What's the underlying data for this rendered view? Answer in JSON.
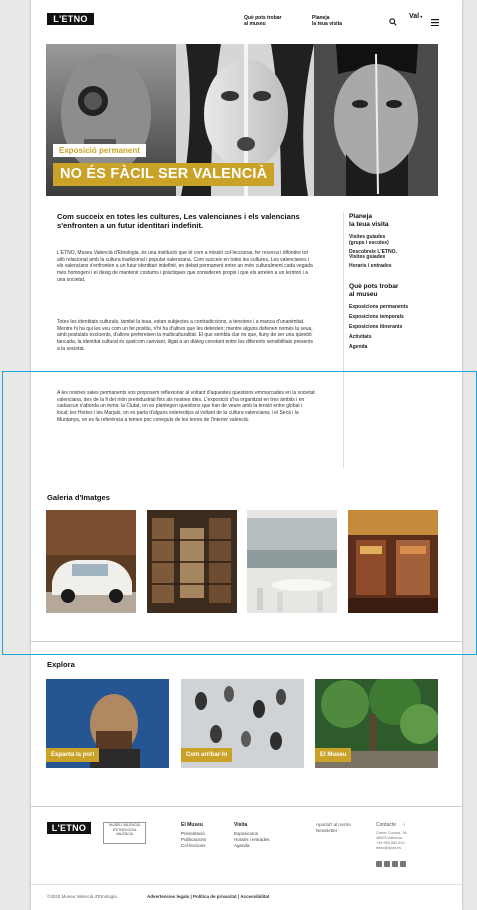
{
  "header": {
    "logo": "L'ETNO",
    "nav": [
      {
        "line1": "Què pots trobar",
        "line2": "al museu"
      },
      {
        "line1": "Planeja",
        "line2": "la teua visita"
      }
    ],
    "language": "Val",
    "search_icon": "search-icon",
    "menu_icon": "menu-icon"
  },
  "hero": {
    "badge": "Exposició permanent",
    "title": "NO ÉS FÀCIL SER VALENCIÀ"
  },
  "intro": {
    "lead": "Com succeix en totes les cultures, Les valencianes i els valencians s'enfronten a un futur identitari indefinit.",
    "p1": "L'ETNO, Museu Valencià d'Etnologia, és una institució que té com a missió col·leccionar, fer recerca i difondre tot allò relacionat amb la cultura tradicional i popular valenciana. Com succeix en totes les cultures, Les valencianes i els valencians s'enfronten a un futur identitari indefinit, en debat permanent entre un món culturalment cada vegada més homogeni i el desig de mantenir costums i pràctiques que consideren propis i que els arrelen a un territori i a una societat.",
    "p2": "Totes les identitats culturals, també la teua, estan subjectes a contradiccions, a tensions i a manca d'unanimitat. Mentre hi ha qui les veu com un fet positiu, n'hi ha d'altres que les detesten; mentre alguns defenen només la seua, amb postulats excloents, d'altres prefereixen la multiculturalitat. El que sembla clar és que, lluny de ser una qüestió tancada, la identitat cultural és quelcom canviant, lligat a un diàleg constant entre les diferents sensibilitats presents a la societat.",
    "p3": "A les nostres sales permanents vos proposem reflexionar al voltant d'aquestes qüestions emmarcades en la societat valenciana, des de la fi del món preindustrial fins als nostres dies. L'exposició s'ha organitzat en tres àmbits i en cadascun s'aborda un tema: la Ciutat, on es plantegen questions que han de veure amb la tensió entre global i local; les Hortes i les Marjals, on es parla d'alguns estereotips al voltant de la cultura valenciana; i el Secà i la Muntanya, on es fa referència a temes poc coneguts de les terres de l'interior valencià."
  },
  "sidebar": {
    "plan_title_1": "Planeja",
    "plan_title_2": "la teua visita",
    "plan_items": [
      "Visites guiades",
      "(grups i escoles)",
      "Descobreix L'ETNO.",
      "Visites guiades",
      "Horaris i entrades"
    ],
    "find_title_1": "Què pots trobar",
    "find_title_2": "al museu",
    "find_items": [
      "Exposicions permanents",
      "Exposicions temporals",
      "Exposicions itinerants",
      "Activitats",
      "Agenda"
    ]
  },
  "gallery": {
    "title": "Galeria d'Imatges"
  },
  "explore": {
    "title": "Explora",
    "cards": [
      "Espanta la por!",
      "Com arribar-hi",
      "El Museu"
    ]
  },
  "footer": {
    "logo": "L'ETNO",
    "logo2": "MUSEU VALENCIÀ D'ETNOLOGIA VALÈNCIA",
    "col1_title": "El Museu",
    "col1_items": [
      "Presentació",
      "Publicacions",
      "Col·leccions"
    ],
    "col2_title": "Visita",
    "col2_items": [
      "Exposicions",
      "Horaris i entrades",
      "Agenda"
    ],
    "col3_title": "Apunta't al nostre Newsletter",
    "col4_title": "Contacte",
    "col4_items": [
      "Carrer Corona, 36",
      "46003 València",
      "+34 963 883 614",
      "letno@dival.es"
    ],
    "copyright": "©2020 Museu Valencià d'Etnologia.",
    "legal": "Advertencies legals | Política de privacitat | Accessibilitat"
  },
  "colors": {
    "accent": "#c9a227",
    "highlight": "#1ba6dc"
  }
}
